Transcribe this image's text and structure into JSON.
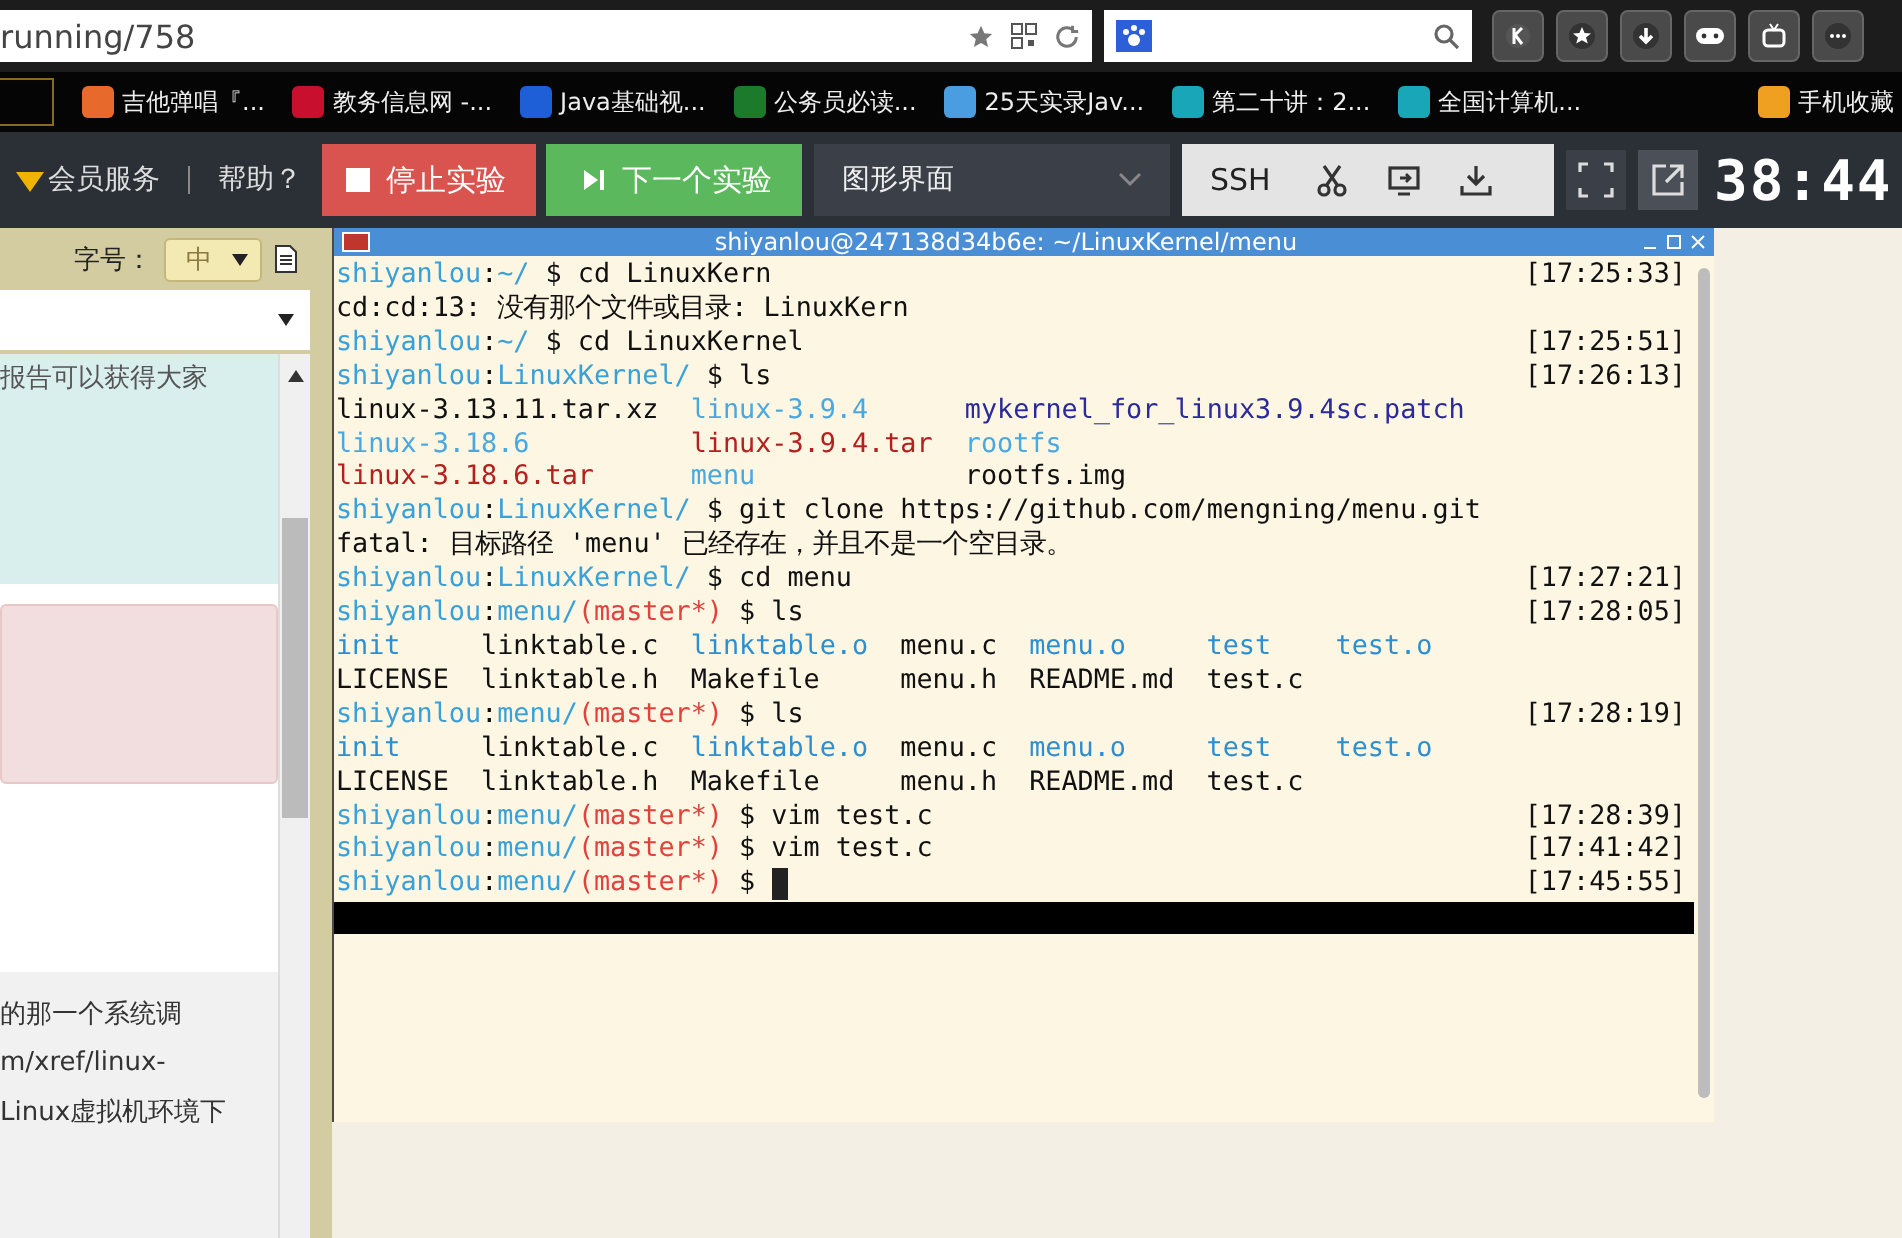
{
  "browser": {
    "address": "running/758",
    "bookmarks": [
      {
        "label": "吉他弹唱『...",
        "color": "#e8692c"
      },
      {
        "label": "教务信息网 -...",
        "color": "#c8102e"
      },
      {
        "label": "Java基础视...",
        "color": "#1e5fd8"
      },
      {
        "label": "公务员必读...",
        "color": "#1b7a2b"
      },
      {
        "label": "25天实录Jav...",
        "color": "#4a9de0"
      },
      {
        "label": "第二十讲：2...",
        "color": "#19a6b8"
      },
      {
        "label": "全国计算机...",
        "color": "#19a6b8"
      },
      {
        "label": "手机收藏",
        "color": "#f0a020"
      }
    ]
  },
  "toolbar": {
    "member": "会员服务",
    "help": "帮助？",
    "stop": "停止实验",
    "next": "下一个实验",
    "mode": "图形界面",
    "ssh": "SSH",
    "timer": "38:44"
  },
  "left_panel": {
    "font_label": "字号：",
    "font_size": "中",
    "panel_text": "报告可以获得大家",
    "lines": [
      "的那一个系统调",
      "m/xref/linux-",
      "Linux虚拟机环境下"
    ]
  },
  "terminal": {
    "title": "shiyanlou@247138d34b6e: ~/LinuxKernel/menu",
    "lines": [
      {
        "kind": "prompt",
        "user": "shiyanlou",
        ":": ":",
        "path": "~/",
        "dollar": "$",
        "command": "cd LinuxKern",
        "time": "[17:25:33]"
      },
      {
        "kind": "output",
        "text": "cd:cd:13: 没有那个文件或目录: LinuxKern"
      },
      {
        "kind": "prompt",
        "user": "shiyanlou",
        ":": ":",
        "path": "~/",
        "dollar": "$",
        "command": "cd LinuxKernel",
        "time": "[17:25:51]"
      },
      {
        "kind": "prompt",
        "user": "shiyanlou",
        ":": ":",
        "path": "LinuxKernel/",
        "dollar": "$",
        "command": "ls",
        "time": "[17:26:13]"
      },
      {
        "kind": "listing",
        "rows": [
          [
            {
              "text": "linux-3.13.11.tar.xz",
              "kind": "file"
            },
            {
              "text": "linux-3.9.4",
              "kind": "dir"
            },
            {
              "text": "mykernel_for_linux3.9.4sc.patch",
              "kind": "patch"
            }
          ],
          [
            {
              "text": "linux-3.18.6",
              "kind": "dir"
            },
            {
              "text": "linux-3.9.4.tar",
              "kind": "archive"
            },
            {
              "text": "rootfs",
              "kind": "dir"
            }
          ],
          [
            {
              "text": "linux-3.18.6.tar",
              "kind": "archive"
            },
            {
              "text": "menu",
              "kind": "dir"
            },
            {
              "text": "rootfs.img",
              "kind": "file"
            }
          ]
        ]
      },
      {
        "kind": "prompt",
        "user": "shiyanlou",
        ":": ":",
        "path": "LinuxKernel/",
        "dollar": "$",
        "command": "git clone https://github.com/mengning/menu.git"
      },
      {
        "kind": "output",
        "text": "fatal: 目标路径 'menu' 已经存在，并且不是一个空目录。"
      },
      {
        "kind": "prompt",
        "user": "shiyanlou",
        ":": ":",
        "path": "LinuxKernel/",
        "dollar": "$",
        "command": "cd menu",
        "time": "[17:27:21]"
      },
      {
        "kind": "prompt",
        "user": "shiyanlou",
        ":": ":",
        "path": "menu/",
        "branch": "(master*)",
        "dollar": "$",
        "command": "ls",
        "time": "[17:28:05]"
      },
      {
        "kind": "listing",
        "rows": [
          [
            {
              "text": "init",
              "kind": "exec"
            },
            {
              "text": "linktable.c",
              "kind": "file"
            },
            {
              "text": "linktable.o",
              "kind": "exec"
            },
            {
              "text": "menu.c",
              "kind": "file"
            },
            {
              "text": "menu.o",
              "kind": "exec"
            },
            {
              "text": "test",
              "kind": "exec"
            },
            {
              "text": "test.o",
              "kind": "exec"
            }
          ],
          [
            {
              "text": "LICENSE",
              "kind": "file"
            },
            {
              "text": "linktable.h",
              "kind": "file"
            },
            {
              "text": "Makefile",
              "kind": "file"
            },
            {
              "text": "menu.h",
              "kind": "file"
            },
            {
              "text": "README.md",
              "kind": "file"
            },
            {
              "text": "test.c",
              "kind": "file"
            }
          ]
        ]
      },
      {
        "kind": "prompt",
        "user": "shiyanlou",
        ":": ":",
        "path": "menu/",
        "branch": "(master*)",
        "dollar": "$",
        "command": "ls",
        "time": "[17:28:19]"
      },
      {
        "kind": "listing",
        "rows": [
          [
            {
              "text": "init",
              "kind": "exec"
            },
            {
              "text": "linktable.c",
              "kind": "file"
            },
            {
              "text": "linktable.o",
              "kind": "exec"
            },
            {
              "text": "menu.c",
              "kind": "file"
            },
            {
              "text": "menu.o",
              "kind": "exec"
            },
            {
              "text": "test",
              "kind": "exec"
            },
            {
              "text": "test.o",
              "kind": "exec"
            }
          ],
          [
            {
              "text": "LICENSE",
              "kind": "file"
            },
            {
              "text": "linktable.h",
              "kind": "file"
            },
            {
              "text": "Makefile",
              "kind": "file"
            },
            {
              "text": "menu.h",
              "kind": "file"
            },
            {
              "text": "README.md",
              "kind": "file"
            },
            {
              "text": "test.c",
              "kind": "file"
            }
          ]
        ]
      },
      {
        "kind": "prompt",
        "user": "shiyanlou",
        ":": ":",
        "path": "menu/",
        "branch": "(master*)",
        "dollar": "$",
        "command": "vim test.c",
        "time": "[17:28:39]"
      },
      {
        "kind": "prompt",
        "user": "shiyanlou",
        ":": ":",
        "path": "menu/",
        "branch": "(master*)",
        "dollar": "$",
        "command": "vim test.c",
        "time": "[17:41:42]"
      },
      {
        "kind": "prompt",
        "user": "shiyanlou",
        ":": ":",
        "path": "menu/",
        "branch": "(master*)",
        "dollar": "$",
        "time": "[17:45:55]",
        "cursor": true
      }
    ]
  }
}
